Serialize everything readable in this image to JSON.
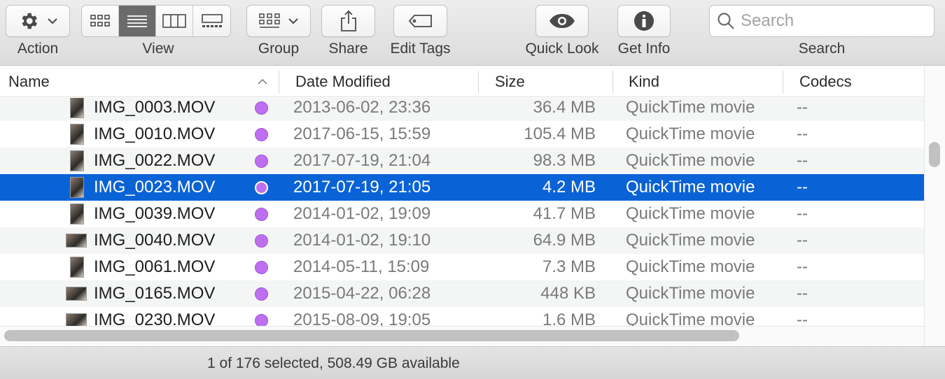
{
  "toolbar": {
    "action_label": "Action",
    "view_label": "View",
    "group_label": "Group",
    "share_label": "Share",
    "edit_tags_label": "Edit Tags",
    "quick_look_label": "Quick Look",
    "get_info_label": "Get Info",
    "search_label": "Search",
    "search_placeholder": "Search",
    "view_active": "list"
  },
  "columns": {
    "name": "Name",
    "date_modified": "Date Modified",
    "size": "Size",
    "kind": "Kind",
    "codecs": "Codecs"
  },
  "files": [
    {
      "name": "IMG_0003.MOV",
      "date": "2013-06-02, 23:36",
      "size": "36.4 MB",
      "kind": "QuickTime movie",
      "codecs": "--",
      "tag_color": "#be6ff0"
    },
    {
      "name": "IMG_0010.MOV",
      "date": "2017-06-15, 15:59",
      "size": "105.4 MB",
      "kind": "QuickTime movie",
      "codecs": "--",
      "tag_color": "#be6ff0"
    },
    {
      "name": "IMG_0022.MOV",
      "date": "2017-07-19, 21:04",
      "size": "98.3 MB",
      "kind": "QuickTime movie",
      "codecs": "--",
      "tag_color": "#be6ff0"
    },
    {
      "name": "IMG_0023.MOV",
      "date": "2017-07-19, 21:05",
      "size": "4.2 MB",
      "kind": "QuickTime movie",
      "codecs": "--",
      "tag_color": "#be6ff0",
      "selected": true
    },
    {
      "name": "IMG_0039.MOV",
      "date": "2014-01-02, 19:09",
      "size": "41.7 MB",
      "kind": "QuickTime movie",
      "codecs": "--",
      "tag_color": "#be6ff0"
    },
    {
      "name": "IMG_0040.MOV",
      "date": "2014-01-02, 19:10",
      "size": "64.9 MB",
      "kind": "QuickTime movie",
      "codecs": "--",
      "tag_color": "#be6ff0"
    },
    {
      "name": "IMG_0061.MOV",
      "date": "2014-05-11, 15:09",
      "size": "7.3 MB",
      "kind": "QuickTime movie",
      "codecs": "--",
      "tag_color": "#be6ff0"
    },
    {
      "name": "IMG_0165.MOV",
      "date": "2015-04-22, 06:28",
      "size": "448 KB",
      "kind": "QuickTime movie",
      "codecs": "--",
      "tag_color": "#be6ff0"
    },
    {
      "name": "IMG_0230.MOV",
      "date": "2015-08-09, 19:05",
      "size": "1.6 MB",
      "kind": "QuickTime movie",
      "codecs": "--",
      "tag_color": "#be6ff0"
    }
  ],
  "status": {
    "text": "1 of 176 selected, 508.49 GB available"
  },
  "colors": {
    "selection": "#0a63d6",
    "tag_purple": "#be6ff0"
  }
}
